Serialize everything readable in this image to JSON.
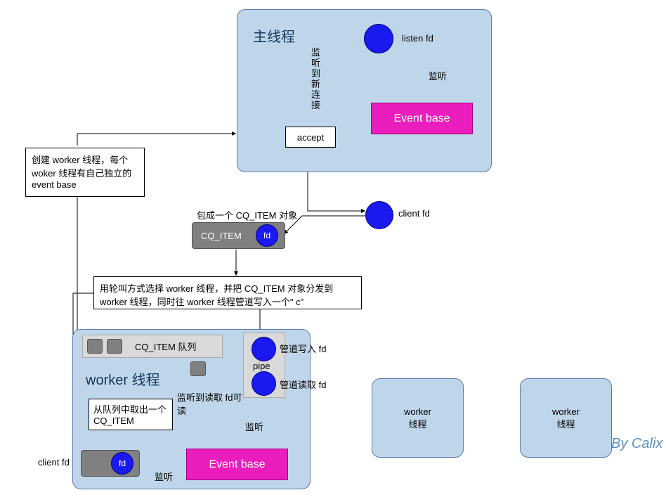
{
  "main_thread": {
    "title": "主线程",
    "listen_fd": "listen fd",
    "listen": "监听",
    "event_base": "Event base",
    "accept": "accept",
    "new_conn": "监听到新连接"
  },
  "left_note": "创建 worker 线程，每个woker 线程有自己独立的 event base",
  "client_fd": "client fd",
  "cq_item_wrap": "包成一个 CQ_ITEM 对象",
  "cq_item": "CQ_ITEM",
  "cq_item_fd": "fd",
  "dispatch_note": "用轮叫方式选择 worker 线程，并把 CQ_ITEM 对象分发到 worker 线程，同时往 worker 线程管道写入一个\" c\"",
  "worker": {
    "title": "worker 线程",
    "queue_label": "CQ_ITEM 队列",
    "pipe": "pipe",
    "pipe_write_fd": "管道写入 fd",
    "pipe_read_fd": "管道读取 fd",
    "listen_readable": "监听到读取 fd可读",
    "listen": "监听",
    "dequeue": "从队列中取出一个 CQ_ITEM",
    "client_fd": "client fd",
    "client_fd_circle": "fd",
    "event_base": "Event base",
    "listen2": "监听"
  },
  "worker_box2": "worker线程",
  "worker_box3": "worker线程",
  "watermark": "By Calix",
  "colors": {
    "panel_bg": "#bfd6ea",
    "panel_border": "#5a7ba6",
    "circle": "#1a1af0",
    "magenta": "#e91ebd",
    "gray": "#808080",
    "lightgray": "#d9d9d9"
  }
}
